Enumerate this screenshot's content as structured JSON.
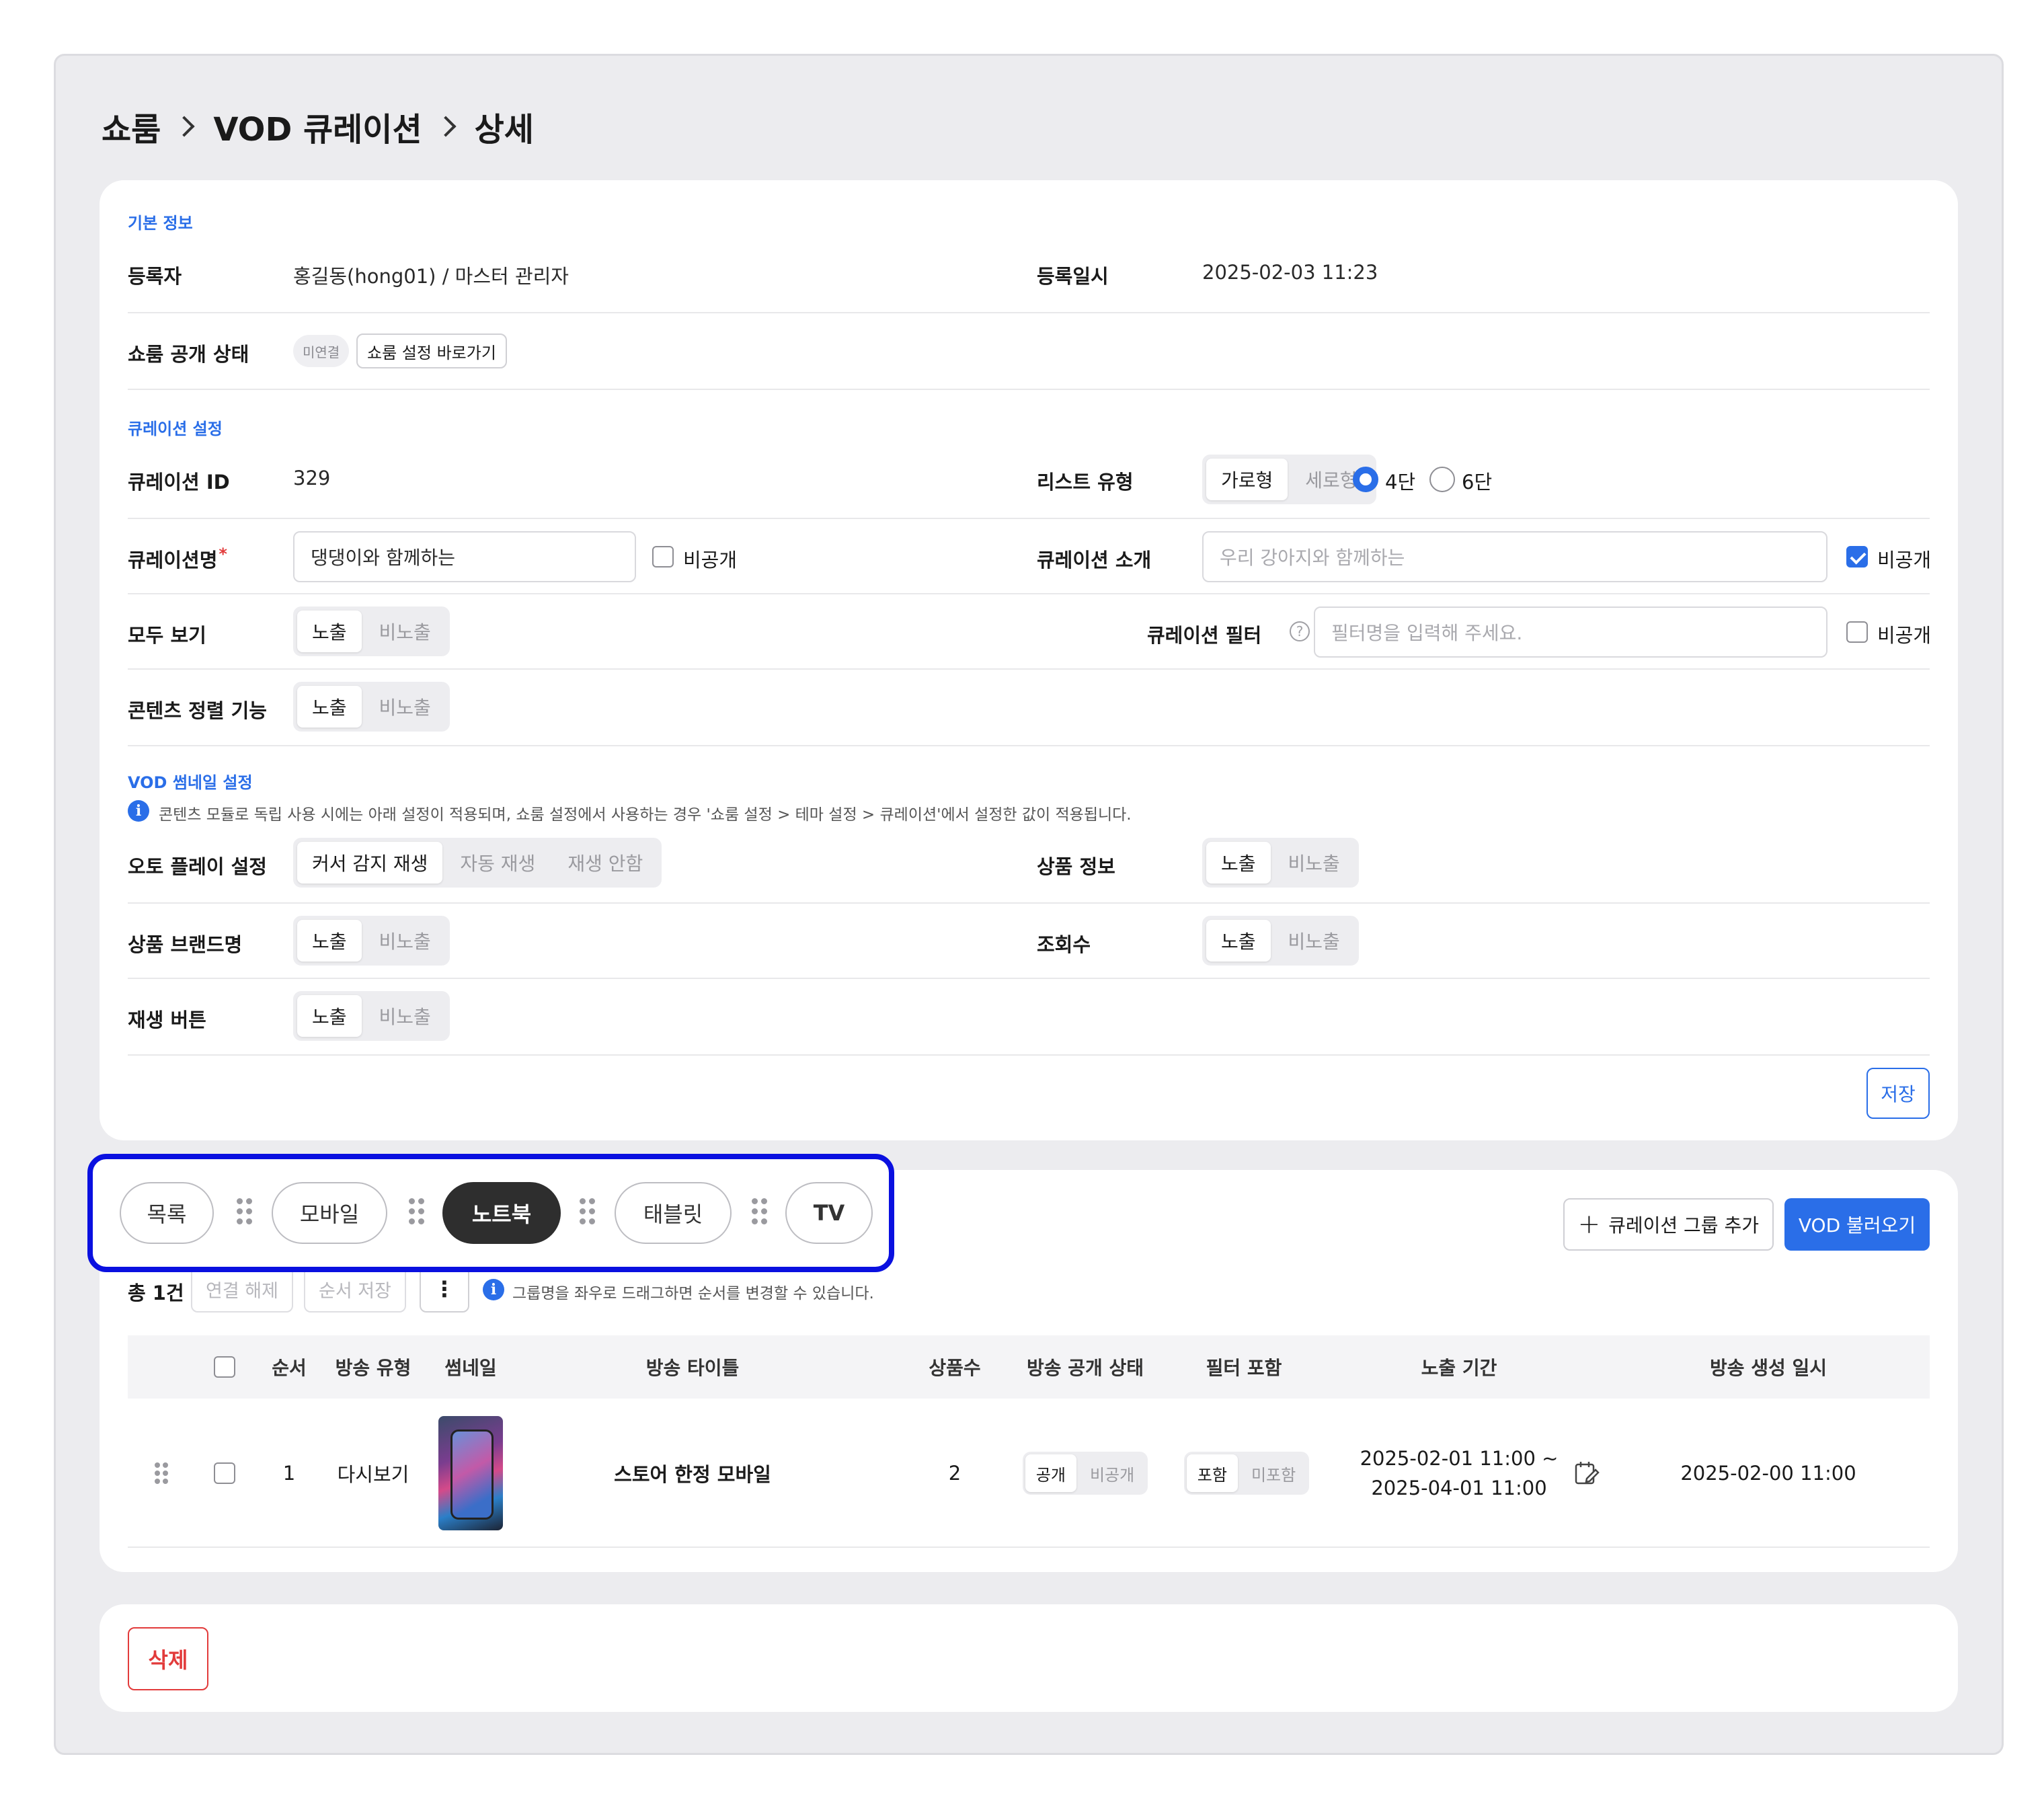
{
  "breadcrumb": [
    "쇼룸",
    "VOD 큐레이션",
    "상세"
  ],
  "basic_info": {
    "section_title": "기본 정보",
    "registrant_label": "등록자",
    "registrant_value": "홍길동(hong01) / 마스터 관리자",
    "registered_at_label": "등록일시",
    "registered_at_value": "2025-02-03 11:23",
    "showroom_status_label": "쇼룸 공개 상태",
    "showroom_status_badge": "미연결",
    "showroom_settings_link": "쇼룸 설정 바로가기"
  },
  "curation_settings": {
    "section_title": "큐레이션 설정",
    "id_label": "큐레이션 ID",
    "id_value": "329",
    "list_type_label": "리스트 유형",
    "list_type_options": [
      "가로형",
      "세로형"
    ],
    "list_type_selected": "가로형",
    "columns_options": [
      "4단",
      "6단"
    ],
    "columns_selected": "4단",
    "name_label": "큐레이션명",
    "name_required_mark": "*",
    "name_value": "댕댕이와 함께하는",
    "name_private_label": "비공개",
    "name_private_checked": false,
    "intro_label": "큐레이션 소개",
    "intro_placeholder": "우리 강아지와 함께하는",
    "intro_private_label": "비공개",
    "intro_private_checked": true,
    "view_all_label": "모두 보기",
    "filter_label": "큐레이션 필터",
    "filter_help_icon": "?",
    "filter_placeholder": "필터명을 입력해 주세요.",
    "filter_private_label": "비공개",
    "filter_private_checked": false,
    "sort_label": "콘텐츠 정렬 기능",
    "show_options": [
      "노출",
      "비노출"
    ]
  },
  "vod_thumbnail": {
    "section_title": "VOD 썸네일 설정",
    "info_icon": "i",
    "info_text": "콘텐츠 모듈로 독립 사용 시에는 아래 설정이 적용되며, 쇼룸 설정에서 사용하는 경우 '쇼룸 설정 > 테마 설정 > 큐레이션'에서 설정한 값이 적용됩니다.",
    "autoplay_label": "오토 플레이 설정",
    "autoplay_options": [
      "커서 감지 재생",
      "자동 재생",
      "재생 안함"
    ],
    "autoplay_selected": "커서 감지 재생",
    "product_info_label": "상품 정보",
    "brand_label": "상품 브랜드명",
    "views_label": "조회수",
    "play_button_label": "재생 버튼",
    "show_options": [
      "노출",
      "비노출"
    ]
  },
  "save_label": "저장",
  "group_tabs": {
    "items": [
      "목록",
      "모바일",
      "노트북",
      "태블릿",
      "TV"
    ],
    "selected": "노트북"
  },
  "actions": {
    "add_group_label": "큐레이션 그룹 추가",
    "load_vod_label": "VOD 불러오기"
  },
  "list": {
    "total_label": "총 1건",
    "disconnect_label": "연결 해제",
    "save_order_label": "순서 저장",
    "more_label": "⋮",
    "info_icon": "i",
    "hint": "그룹명을 좌우로 드래그하면 순서를 변경할 수 있습니다.",
    "columns": [
      "순서",
      "방송 유형",
      "썸네일",
      "방송 타이틀",
      "상품수",
      "방송 공개 상태",
      "필터 포함",
      "노출 기간",
      "방송 생성 일시"
    ],
    "rows": [
      {
        "order": "1",
        "type": "다시보기",
        "title": "스토어 한정 모바일",
        "product_count": "2",
        "public_options": [
          "공개",
          "비공개"
        ],
        "public_selected": "공개",
        "filter_options": [
          "포함",
          "미포함"
        ],
        "filter_selected": "포함",
        "period_start": "2025-02-01 11:00 ~",
        "period_end": "2025-04-01 11:00",
        "created_at": "2025-02-00 11:00"
      }
    ]
  },
  "delete_label": "삭제",
  "colors": {
    "accent": "#2a6ee8",
    "danger": "#e23b3b",
    "highlight_border": "#0a10e0",
    "selected_tab": "#2e2e2e",
    "page_bg": "#ececef"
  },
  "icons": {
    "breadcrumb_separator": "chevron-right-icon",
    "drag_handle": "drag-handle-icon",
    "edit_period": "calendar-edit-icon",
    "add": "plus-icon",
    "help": "question-circle-icon",
    "info": "info-circle-icon"
  }
}
